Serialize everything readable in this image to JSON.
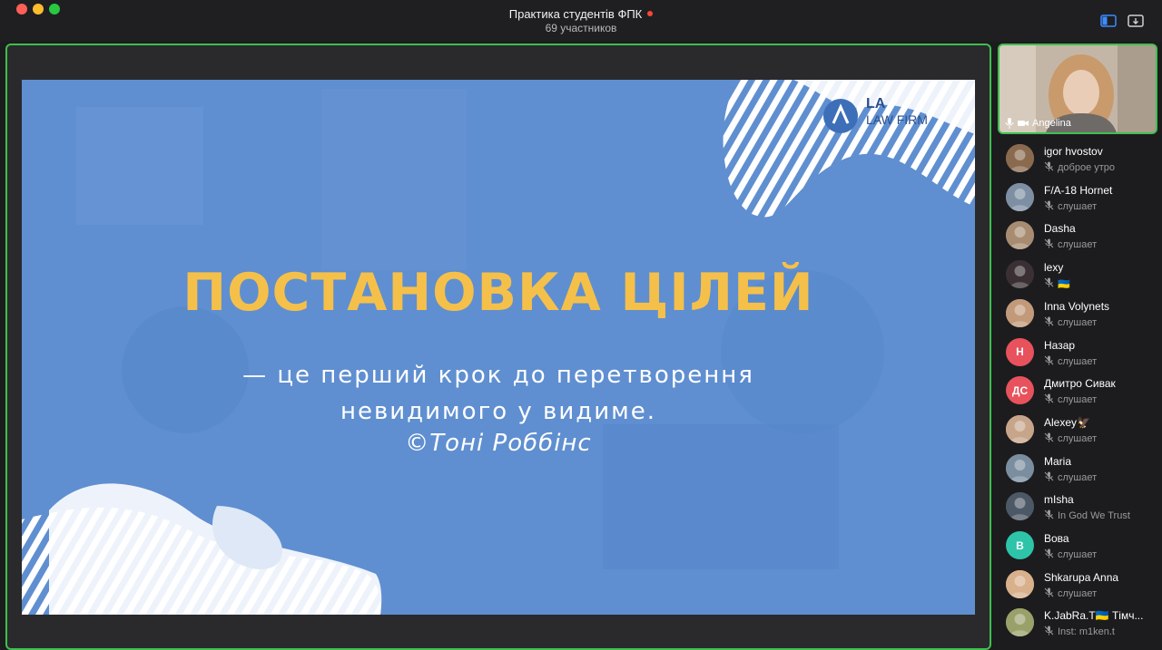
{
  "window": {
    "title": "Практика студентів ФПК",
    "subtitle": "69 участников",
    "recording_color": "#ff453a"
  },
  "toolbar": {
    "sidebar_icon": "sidebar-icon",
    "pip_icon": "pip-icon"
  },
  "slide": {
    "title": "ПОСТАНОВКА ЦІЛЕЙ",
    "quote_line1": "— це перший крок до перетворення",
    "quote_line2": "невидимого у видиме.",
    "author": "©Тоні Роббінс",
    "logo_la": "LA",
    "logo_firm": "LAW FIRM",
    "title_color": "#f5c04a",
    "bg_color": "#5f8fd0"
  },
  "speaker": {
    "name": "Angelina",
    "active_border_color": "#3fbf4f"
  },
  "participants": [
    {
      "name": "igor hvostov",
      "status": "доброе утро",
      "avatar_initials": "",
      "avatar_color": "#8a6a4f"
    },
    {
      "name": "F/A-18 Hornet",
      "status": "слушает",
      "avatar_initials": "",
      "avatar_color": "#7f8fa3"
    },
    {
      "name": "Dasha",
      "status": "слушает",
      "avatar_initials": "",
      "avatar_color": "#a88c72"
    },
    {
      "name": "lexy",
      "status": "🇺🇦",
      "avatar_initials": "",
      "avatar_color": "#3a2f33"
    },
    {
      "name": "Inna Volynets",
      "status": "слушает",
      "avatar_initials": "",
      "avatar_color": "#c29a7a"
    },
    {
      "name": "Назар",
      "status": "слушает",
      "avatar_initials": "Н",
      "avatar_color": "#e8525d"
    },
    {
      "name": "Дмитро Сивак",
      "status": "слушает",
      "avatar_initials": "ДС",
      "avatar_color": "#e8525d"
    },
    {
      "name": "Alexey🦅",
      "status": "слушает",
      "avatar_initials": "",
      "avatar_color": "#c7a58a"
    },
    {
      "name": "Maria",
      "status": "слушает",
      "avatar_initials": "",
      "avatar_color": "#7a8ea0"
    },
    {
      "name": "mIsha",
      "status": "In God We Trust",
      "avatar_initials": "",
      "avatar_color": "#4d5866"
    },
    {
      "name": "Вова",
      "status": "слушает",
      "avatar_initials": "В",
      "avatar_color": "#2ec4a9"
    },
    {
      "name": "Shkarupa Anna",
      "status": "слушает",
      "avatar_initials": "",
      "avatar_color": "#d9b08c"
    },
    {
      "name": "K.JabRa.T🇺🇦 Тімч...",
      "status": "Inst: m1ken.t",
      "avatar_initials": "",
      "avatar_color": "#9aa06a"
    }
  ]
}
